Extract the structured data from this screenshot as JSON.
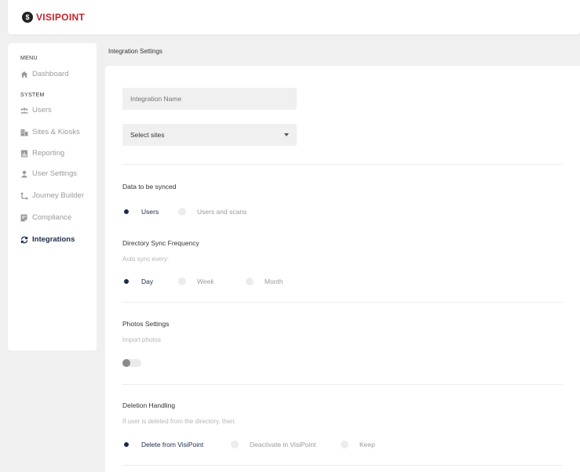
{
  "brand": {
    "logo_glyph": "$",
    "name": "VISIPOINT",
    "accent": "#c8202b"
  },
  "sidebar": {
    "menu_heading": "MENU",
    "system_heading": "SYSTEM",
    "items": [
      {
        "label": "Dashboard",
        "icon": "home-icon"
      },
      {
        "label": "Users",
        "icon": "users-icon"
      },
      {
        "label": "Sites & Kiosks",
        "icon": "building-icon"
      },
      {
        "label": "Reporting",
        "icon": "report-icon"
      },
      {
        "label": "User Settings",
        "icon": "user-icon"
      },
      {
        "label": "Journey Builder",
        "icon": "journey-icon"
      },
      {
        "label": "Compliance",
        "icon": "compliance-icon"
      },
      {
        "label": "Integrations",
        "icon": "sync-icon",
        "active": true
      }
    ]
  },
  "page": {
    "title": "Integration Settings"
  },
  "form": {
    "integration_name_placeholder": "Integration Name",
    "select_sites_label": "Select sites",
    "data_sync": {
      "title": "Data to be synced",
      "options": [
        "Users",
        "Users and scans"
      ],
      "selected": "Users"
    },
    "directory_sync": {
      "title": "Directory Sync Frequency",
      "hint": "Auto sync every:",
      "options": [
        "Day",
        "Week",
        "Month"
      ],
      "selected": "Day"
    },
    "photos": {
      "title": "Photos Settings",
      "hint": "Import photos",
      "enabled": false
    },
    "deletion": {
      "title": "Deletion Handling",
      "hint": "If user is deleted from the directory, then:",
      "options": [
        "Delete from VisiPoint",
        "Deactivate in VisiPoint",
        "Keep"
      ],
      "selected": "Delete from VisiPoint"
    }
  }
}
